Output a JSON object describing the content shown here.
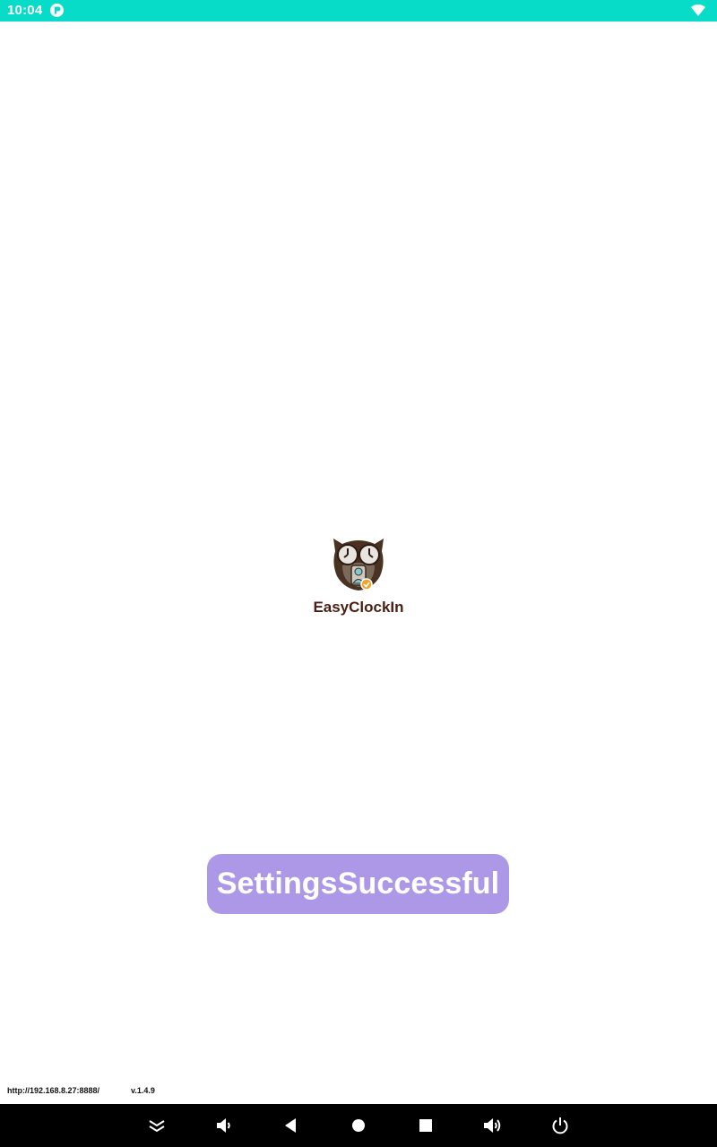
{
  "status_bar": {
    "time": "10:04",
    "app_icon": "notification-app-icon",
    "wifi_icon": "wifi-icon",
    "background_color": "#06dcc8"
  },
  "splash": {
    "logo_icon": "owl-clock-logo-icon",
    "app_name": "EasyClockIn",
    "app_name_color": "#4a1f12"
  },
  "toast": {
    "message": "SettingsSuccessful",
    "background_color": "#ad98e8"
  },
  "footer": {
    "url": "http://192.168.8.27:8888/",
    "version": "v.1.4.9"
  },
  "nav_bar": {
    "buttons": [
      {
        "icon": "collapse-chevrons-icon"
      },
      {
        "icon": "volume-down-icon"
      },
      {
        "icon": "back-icon"
      },
      {
        "icon": "home-icon"
      },
      {
        "icon": "recents-icon"
      },
      {
        "icon": "volume-up-icon"
      },
      {
        "icon": "power-icon"
      }
    ]
  }
}
